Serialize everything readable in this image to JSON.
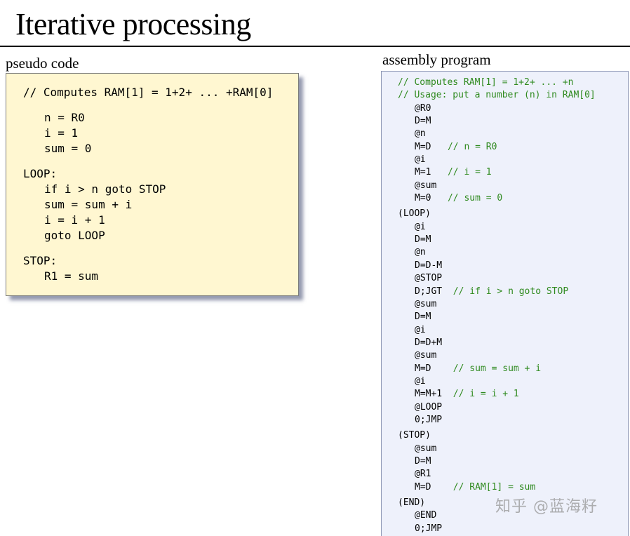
{
  "title": "Iterative processing",
  "pseudo": {
    "label": "pseudo code",
    "lines": [
      {
        "text": "// Computes RAM[1] = 1+2+ ... +RAM[0]",
        "indent": false,
        "comment": true
      },
      {
        "gap": true
      },
      {
        "text": "n = R0",
        "indent": true
      },
      {
        "text": "i = 1",
        "indent": true
      },
      {
        "text": "sum = 0",
        "indent": true
      },
      {
        "gap": true
      },
      {
        "text": "LOOP:",
        "indent": false
      },
      {
        "text": "if i > n goto STOP",
        "indent": true
      },
      {
        "text": "sum = sum + i",
        "indent": true
      },
      {
        "text": "i = i + 1",
        "indent": true
      },
      {
        "text": "goto LOOP",
        "indent": true
      },
      {
        "gap": true
      },
      {
        "text": "STOP:",
        "indent": false
      },
      {
        "text": "R1 = sum",
        "indent": true
      }
    ]
  },
  "assembly": {
    "label": "assembly program",
    "lines": [
      {
        "code": "",
        "comment": "// Computes RAM[1] = 1+2+ ... +n",
        "indent": false
      },
      {
        "code": "",
        "comment": "// Usage: put a number (n) in RAM[0]",
        "indent": false
      },
      {
        "code": "@R0",
        "indent": true
      },
      {
        "code": "D=M",
        "indent": true
      },
      {
        "code": "@n",
        "indent": true
      },
      {
        "code": "M=D   ",
        "comment": "// n = R0",
        "indent": true
      },
      {
        "code": "@i",
        "indent": true
      },
      {
        "code": "M=1   ",
        "comment": "// i = 1",
        "indent": true
      },
      {
        "code": "@sum",
        "indent": true
      },
      {
        "code": "M=0   ",
        "comment": "// sum = 0",
        "indent": true
      },
      {
        "gap": true
      },
      {
        "code": "(LOOP)",
        "indent": false
      },
      {
        "code": "@i",
        "indent": true
      },
      {
        "code": "D=M",
        "indent": true
      },
      {
        "code": "@n",
        "indent": true
      },
      {
        "code": "D=D-M",
        "indent": true
      },
      {
        "code": "@STOP",
        "indent": true
      },
      {
        "code": "D;JGT  ",
        "comment": "// if i > n goto STOP",
        "indent": true
      },
      {
        "code": "@sum",
        "indent": true
      },
      {
        "code": "D=M",
        "indent": true
      },
      {
        "code": "@i",
        "indent": true
      },
      {
        "code": "D=D+M",
        "indent": true
      },
      {
        "code": "@sum",
        "indent": true
      },
      {
        "code": "M=D    ",
        "comment": "// sum = sum + i",
        "indent": true
      },
      {
        "code": "@i",
        "indent": true
      },
      {
        "code": "M=M+1  ",
        "comment": "// i = i + 1",
        "indent": true
      },
      {
        "code": "@LOOP",
        "indent": true
      },
      {
        "code": "0;JMP",
        "indent": true
      },
      {
        "gap": true
      },
      {
        "code": "(STOP)",
        "indent": false
      },
      {
        "code": "@sum",
        "indent": true
      },
      {
        "code": "D=M",
        "indent": true
      },
      {
        "code": "@R1",
        "indent": true
      },
      {
        "code": "M=D    ",
        "comment": "// RAM[1] = sum",
        "indent": true
      },
      {
        "gap": true
      },
      {
        "code": "(END)",
        "indent": false
      },
      {
        "code": "@END",
        "indent": true
      },
      {
        "code": "0;JMP",
        "indent": true
      }
    ]
  },
  "watermark": "知乎 @蓝海籽",
  "colors": {
    "comment": "#2f8a1f",
    "pseudo_background": "#fff7d1",
    "assembly_background": "#eef1fb"
  }
}
